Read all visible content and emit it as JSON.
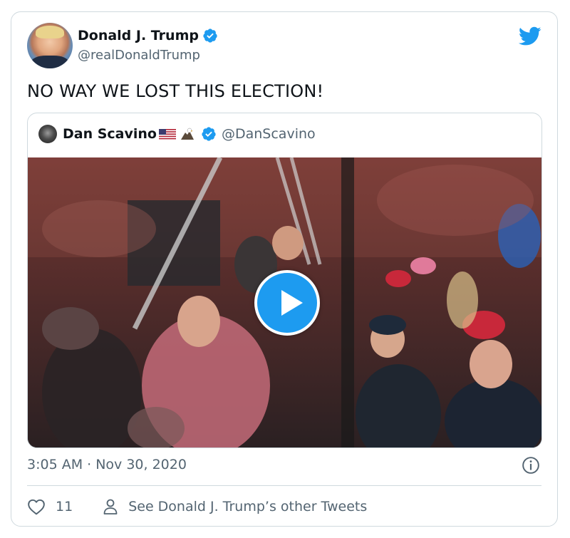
{
  "tweet": {
    "display_name": "Donald J. Trump",
    "handle": "@realDonaldTrump",
    "text": "NO WAY WE LOST THIS ELECTION!",
    "timestamp": "3:05 AM · Nov 30, 2020",
    "like_count": "11",
    "see_other_label": "See Donald J. Trump’s other Tweets"
  },
  "quoted": {
    "display_name": "Dan Scavino",
    "handle": "@DanScavino",
    "emoji": [
      "us-flag",
      "eagle"
    ]
  },
  "icons": {
    "verified": "verified-badge-icon",
    "brand": "twitter-bird-icon",
    "play": "play-icon",
    "info": "info-icon",
    "like": "heart-icon",
    "profile": "person-icon"
  },
  "colors": {
    "brand_blue": "#1d9bf0",
    "text_primary": "#0f1419",
    "text_secondary": "#536471",
    "border": "#cfd9de"
  }
}
